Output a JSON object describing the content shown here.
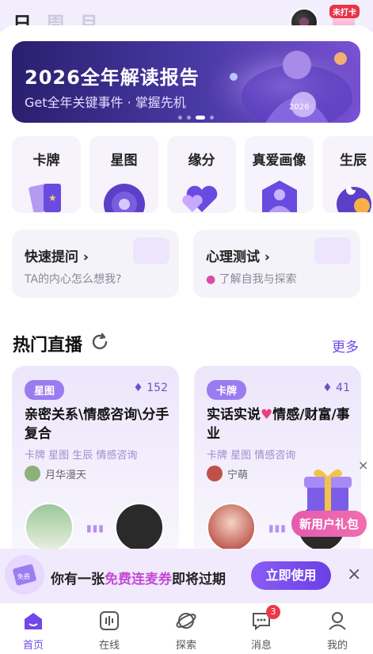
{
  "top": {
    "tabs": [
      "日",
      "周",
      "月"
    ],
    "checkin_badge": "未打卡"
  },
  "banner": {
    "title": "2026全年解读报告",
    "subtitle": "Get全年关键事件 · 掌握先机",
    "art_text": "2026",
    "page_count": 4,
    "active_page": 3
  },
  "categories": [
    {
      "label": "卡牌",
      "icon": "tarot-cards-icon"
    },
    {
      "label": "星图",
      "icon": "zodiac-wheel-icon"
    },
    {
      "label": "缘分",
      "icon": "hearts-icon"
    },
    {
      "label": "真爱画像",
      "icon": "portrait-icon"
    },
    {
      "label": "生辰",
      "icon": "moon-sun-icon"
    }
  ],
  "quick_actions": [
    {
      "title": "快速提问",
      "subtitle": "TA的内心怎么想我?"
    },
    {
      "title": "心理测试",
      "subtitle": "了解自我与探索"
    }
  ],
  "live": {
    "section_title": "热门直播",
    "more_label": "更多",
    "cards": [
      {
        "tag": "星图",
        "count": "152",
        "title": "亲密关系\\情感咨询\\分手复合",
        "tags": "卡牌  星图  生辰  情感咨询",
        "host": "月华漫天"
      },
      {
        "tag": "卡牌",
        "count": "41",
        "title_a": "实话实说",
        "title_b": "情感/财富/事业",
        "tags": "卡牌  星图  情感咨询",
        "host": "宁萌"
      }
    ]
  },
  "floating_gift": {
    "label": "新用户礼包",
    "close": "×"
  },
  "promo": {
    "text_before": "你有一张",
    "text_highlight": "免费连麦券",
    "text_after": "即将过期",
    "button": "立即使用",
    "close": "×",
    "ticket_text": "免费"
  },
  "tabbar": [
    {
      "label": "首页",
      "active": true
    },
    {
      "label": "在线",
      "active": false
    },
    {
      "label": "探索",
      "active": false
    },
    {
      "label": "消息",
      "active": false,
      "badge": "3"
    },
    {
      "label": "我的",
      "active": false
    }
  ],
  "colors": {
    "accent": "#7048e8",
    "tag": "#9b7cf0",
    "highlight": "#c44bd4"
  }
}
